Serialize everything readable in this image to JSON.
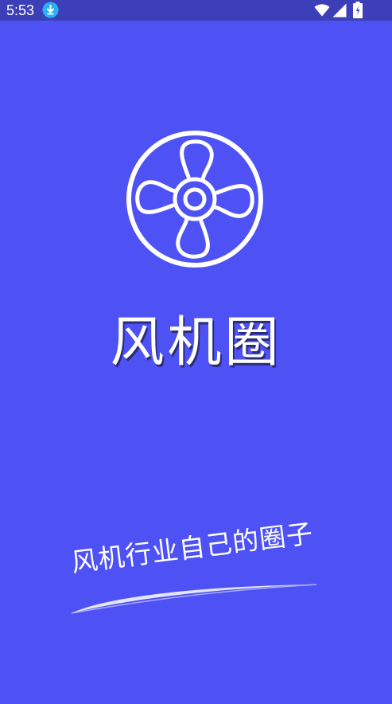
{
  "status_bar": {
    "time": "5:53"
  },
  "splash": {
    "app_name": "风机圈",
    "slogan": "风机行业自己的圈子"
  },
  "colors": {
    "background": "#4e52f5",
    "status_bar": "#3c3fb8",
    "foreground": "#ffffff",
    "download_badge": "#2ab0f5"
  },
  "icons": {
    "download": "download-icon",
    "wifi": "wifi-icon",
    "signal": "cell-signal-icon",
    "battery": "battery-charging-icon",
    "logo": "fan-logo-icon"
  }
}
